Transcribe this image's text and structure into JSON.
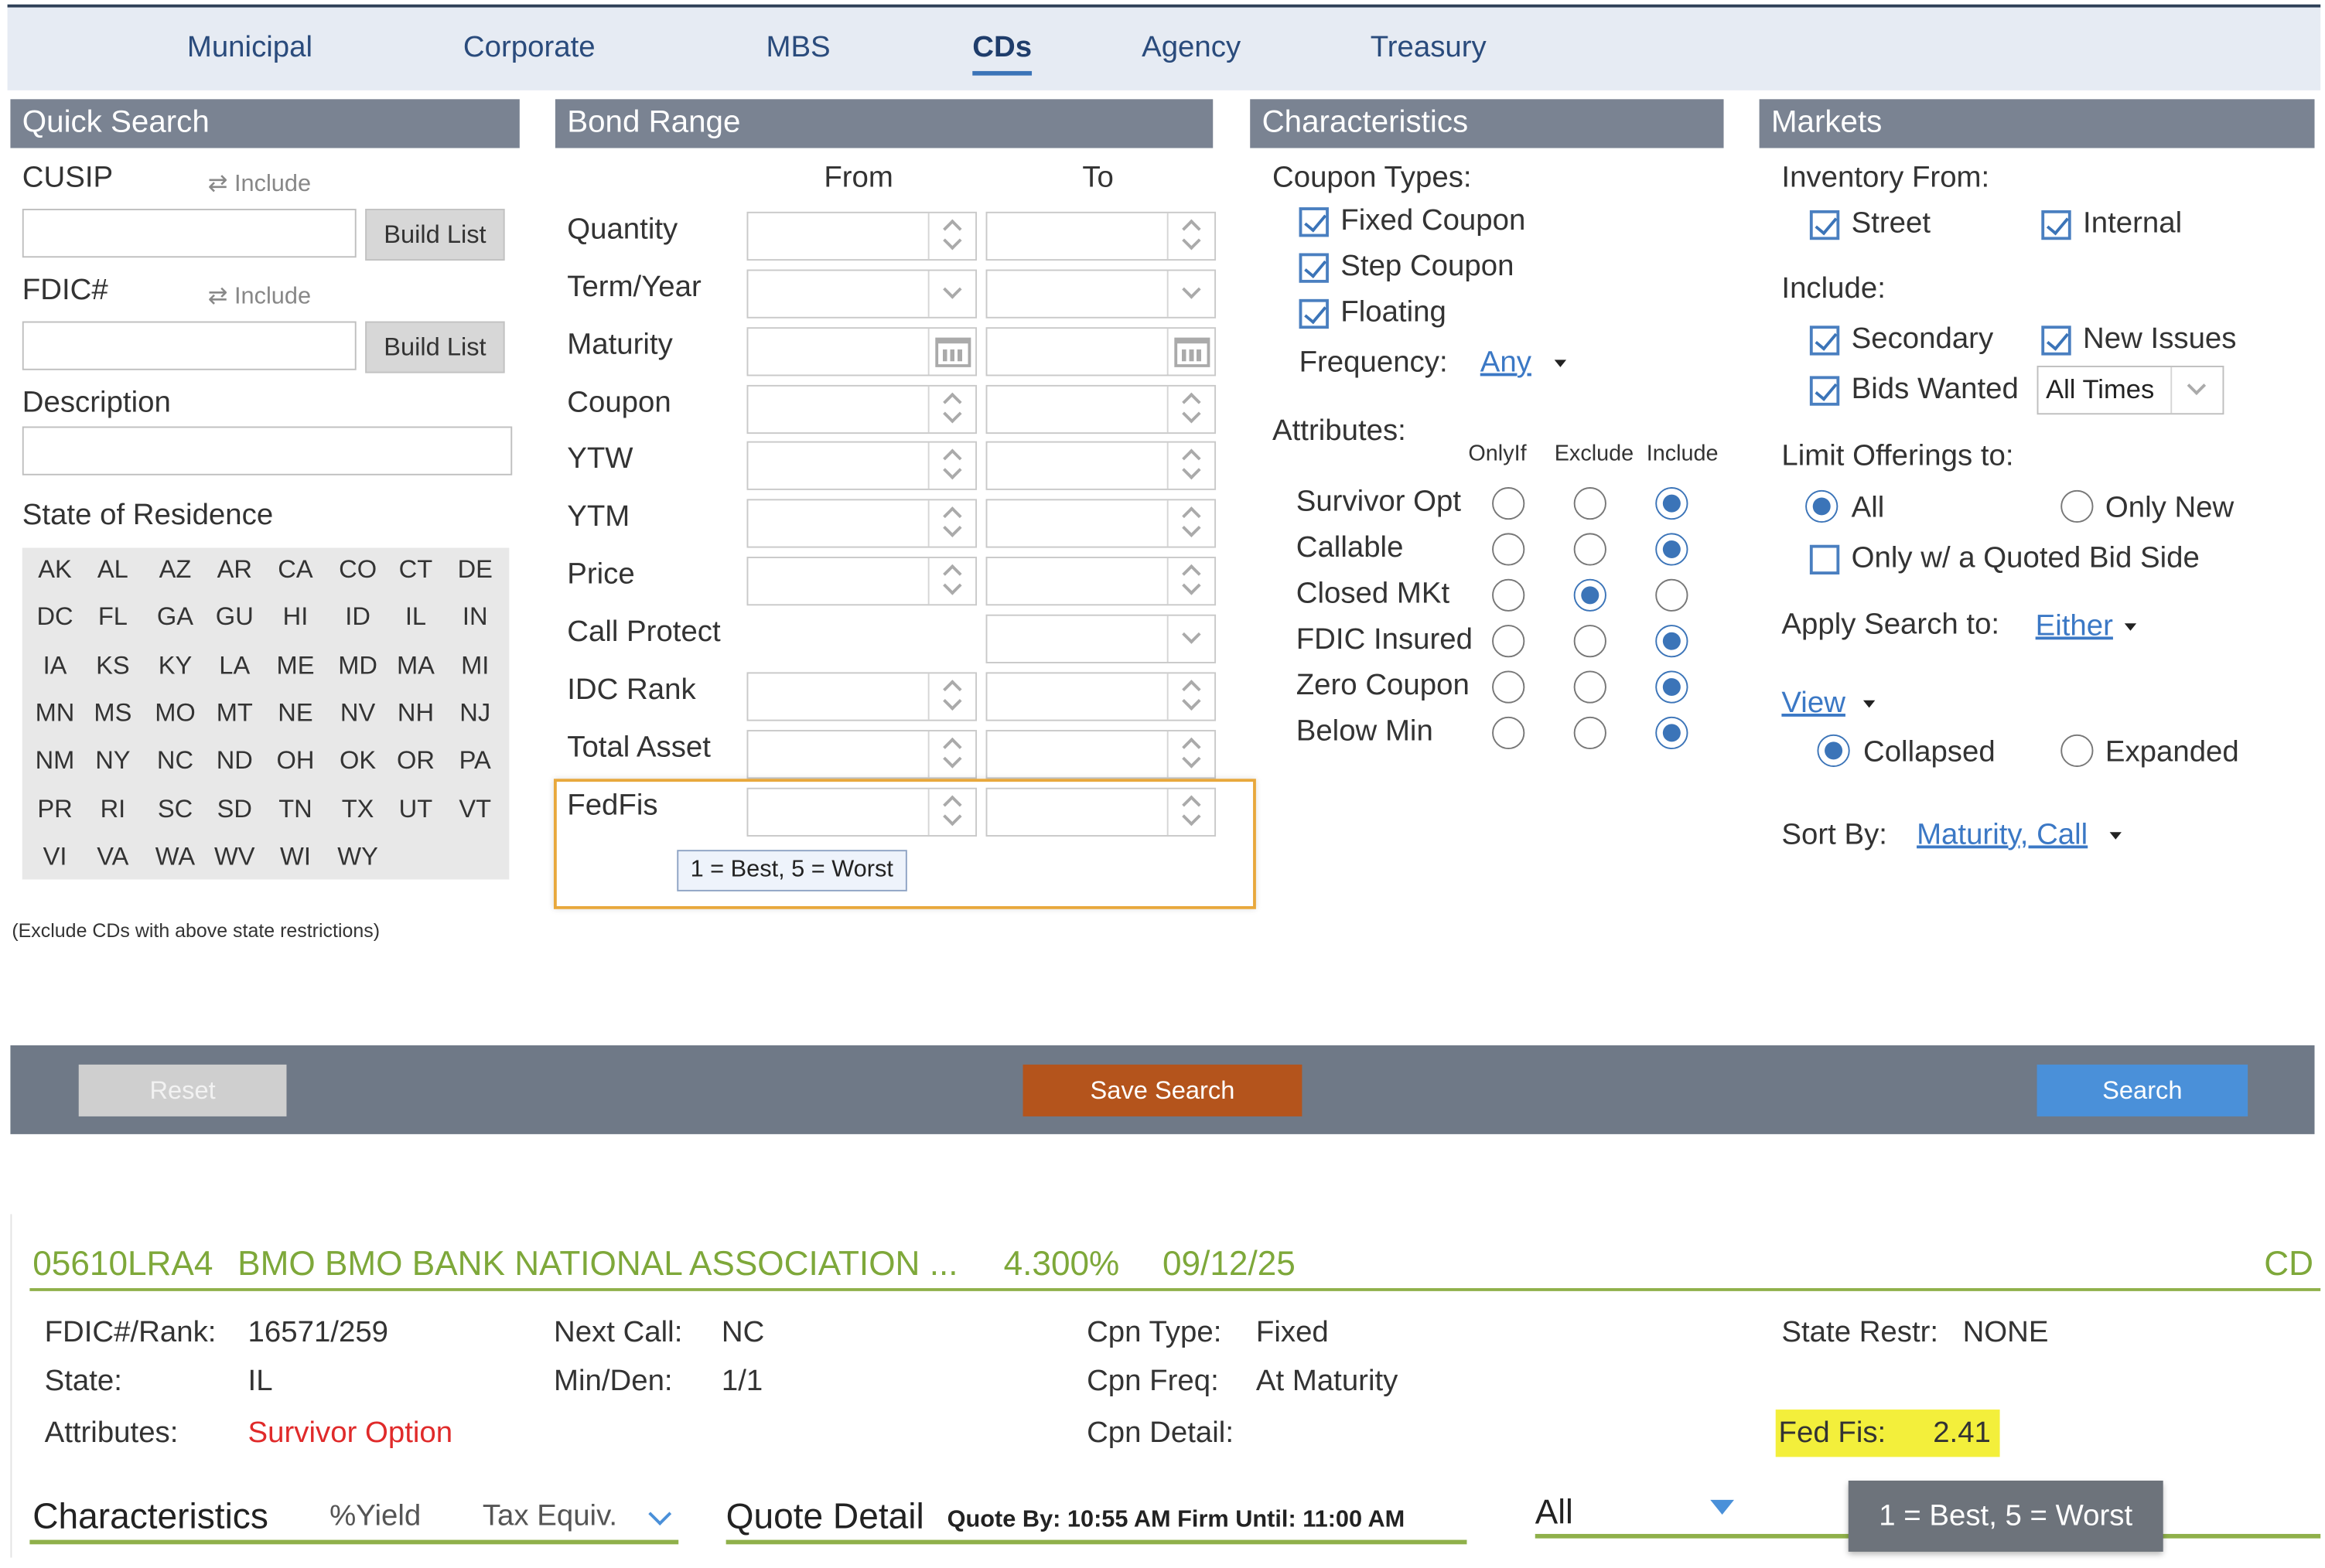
{
  "tabs": [
    "Municipal",
    "Corporate",
    "MBS",
    "CDs",
    "Agency",
    "Treasury"
  ],
  "active_tab": "CDs",
  "quick_search": {
    "title": "Quick Search",
    "cusip_label": "CUSIP",
    "fdic_label": "FDIC#",
    "include_label": "Include",
    "build_list": "Build List",
    "description_label": "Description",
    "state_label": "State of Residence",
    "states": [
      "AK",
      "AL",
      "AZ",
      "AR",
      "CA",
      "CO",
      "CT",
      "DE",
      "DC",
      "FL",
      "GA",
      "GU",
      "HI",
      "ID",
      "IL",
      "IN",
      "IA",
      "KS",
      "KY",
      "LA",
      "ME",
      "MD",
      "MA",
      "MI",
      "MN",
      "MS",
      "MO",
      "MT",
      "NE",
      "NV",
      "NH",
      "NJ",
      "NM",
      "NY",
      "NC",
      "ND",
      "OH",
      "OK",
      "OR",
      "PA",
      "PR",
      "RI",
      "SC",
      "SD",
      "TN",
      "TX",
      "UT",
      "VT",
      "VI",
      "VA",
      "WA",
      "WV",
      "WI",
      "WY"
    ],
    "state_note": "(Exclude CDs with above state restrictions)"
  },
  "bond_range": {
    "title": "Bond Range",
    "from_label": "From",
    "to_label": "To",
    "rows": [
      "Quantity",
      "Term/Year",
      "Maturity",
      "Coupon",
      "YTW",
      "YTM",
      "Price",
      "Call Protect",
      "IDC Rank",
      "Total Asset",
      "FedFis"
    ],
    "fedfis_tooltip": "1 = Best, 5 = Worst"
  },
  "characteristics": {
    "title": "Characteristics",
    "coupon_types_label": "Coupon Types:",
    "coupon_types": [
      "Fixed Coupon",
      "Step Coupon",
      "Floating"
    ],
    "frequency_label": "Frequency:",
    "frequency_value": "Any",
    "attributes_label": "Attributes:",
    "attr_cols": [
      "OnlyIf",
      "Exclude",
      "Include"
    ],
    "attributes": [
      {
        "name": "Survivor Opt",
        "selected": "Include"
      },
      {
        "name": "Callable",
        "selected": "Include"
      },
      {
        "name": "Closed MKt",
        "selected": "Exclude"
      },
      {
        "name": "FDIC Insured",
        "selected": "Include"
      },
      {
        "name": "Zero Coupon",
        "selected": "Include"
      },
      {
        "name": "Below Min",
        "selected": "Include"
      }
    ]
  },
  "markets": {
    "title": "Markets",
    "inventory_label": "Inventory From:",
    "street": "Street",
    "internal": "Internal",
    "include_label": "Include:",
    "secondary": "Secondary",
    "new_issues": "New Issues",
    "bids_wanted": "Bids Wanted",
    "bids_wanted_value": "All Times",
    "limit_label": "Limit Offerings to:",
    "all": "All",
    "only_new": "Only New",
    "only_quoted": "Only w/ a Quoted Bid Side",
    "apply_label": "Apply Search to:",
    "apply_value": "Either",
    "view_label": "View",
    "collapsed": "Collapsed",
    "expanded": "Expanded",
    "sort_label": "Sort By:",
    "sort_value": "Maturity, Call"
  },
  "actions": {
    "reset": "Reset",
    "save": "Save Search",
    "search": "Search"
  },
  "result": {
    "cusip": "05610LRA4",
    "name": "BMO BMO BANK NATIONAL ASSOCIATION ...",
    "rate": "4.300%",
    "date": "09/12/25",
    "type": "CD",
    "fdic_label": "FDIC#/Rank:",
    "fdic_value": "16571/259",
    "state_label": "State:",
    "state_value": "IL",
    "attributes_label": "Attributes:",
    "attributes_value": "Survivor Option",
    "next_call_label": "Next Call:",
    "next_call_value": "NC",
    "minden_label": "Min/Den:",
    "minden_value": "1/1",
    "cpn_type_label": "Cpn Type:",
    "cpn_type_value": "Fixed",
    "cpn_freq_label": "Cpn Freq:",
    "cpn_freq_value": "At Maturity",
    "cpn_detail_label": "Cpn Detail:",
    "state_restr_label": "State Restr:",
    "state_restr_value": "NONE",
    "fedfis_label": "Fed Fis:",
    "fedfis_value": "2.41",
    "tabs": {
      "characteristics": "Characteristics",
      "yield": "%Yield",
      "tax": "Tax Equiv.",
      "quote_detail": "Quote Detail",
      "quote_by": "Quote By: 10:55 AM Firm Until: 11:00 AM",
      "all": "All"
    },
    "tooltip": "1 = Best, 5 = Worst"
  },
  "colors": {
    "header": "#7a8392",
    "save": "#b4541c",
    "search": "#4a90d9",
    "accent_green": "#7ea83a",
    "link": "#3b78c5",
    "highlight": "#f3ef3b",
    "focus_box": "#e8a83c"
  }
}
